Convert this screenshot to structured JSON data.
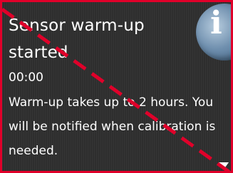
{
  "notification": {
    "title": "Sensor warm-up started",
    "time": "00:00",
    "message": "Warm-up takes up to 2 hours. You will be notified when calibration is needed."
  },
  "icons": {
    "info": "info-icon",
    "scroll": "scroll-down-arrow-icon"
  },
  "info_icon_glyph": "i",
  "colors": {
    "background": "#2e2e2e",
    "text": "#ffffff",
    "annotation_red": "#e0002a",
    "info_icon_blue": "#6f8fae"
  }
}
